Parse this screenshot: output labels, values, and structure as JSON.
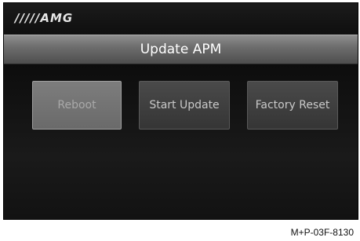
{
  "header": {
    "logo_text": "/////AMG"
  },
  "title_bar": {
    "title": "Update APM"
  },
  "buttons": {
    "reboot_label": "Reboot",
    "start_update_label": "Start Update",
    "factory_reset_label": "Factory Reset"
  },
  "footer": {
    "reference_code": "M+P-03F-8130"
  },
  "colors": {
    "screen_background": "#111111",
    "title_bar": "#6e6e6e",
    "button": "#3f3f3f",
    "button_highlighted": "#747474",
    "text_primary": "#ffffff"
  },
  "state": {
    "highlighted_button": "Reboot"
  }
}
